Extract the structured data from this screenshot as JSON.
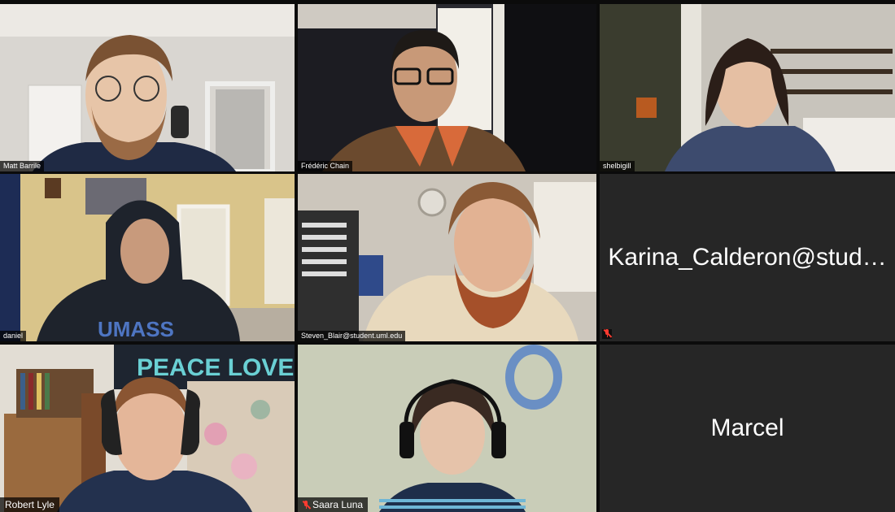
{
  "participants": [
    {
      "name": "Matt Barrile",
      "video": true,
      "muted": false,
      "active_speaker": false
    },
    {
      "name": "Frédéric Chain",
      "video": true,
      "muted": false,
      "active_speaker": true
    },
    {
      "name": "shelbigill",
      "video": true,
      "muted": false,
      "active_speaker": false
    },
    {
      "name": "daniel",
      "video": true,
      "muted": false,
      "active_speaker": false
    },
    {
      "name": "Steven_Blair@student.uml.edu",
      "video": true,
      "muted": false,
      "active_speaker": false
    },
    {
      "name": "Karina_Calderon@student.uml.edu",
      "display_name": "Karina_Calderon@stud…",
      "video": false,
      "muted": true,
      "active_speaker": false
    },
    {
      "name": "Robert Lyle",
      "video": true,
      "muted": false,
      "active_speaker": false
    },
    {
      "name": "Saara Luna",
      "video": true,
      "muted": true,
      "active_speaker": false
    },
    {
      "name": "Marcel",
      "video": false,
      "muted": false,
      "active_speaker": false
    }
  ],
  "colors": {
    "active_speaker_border": "#e8d66a",
    "muted_icon": "#ff3b30",
    "empty_tile": "#262626"
  }
}
